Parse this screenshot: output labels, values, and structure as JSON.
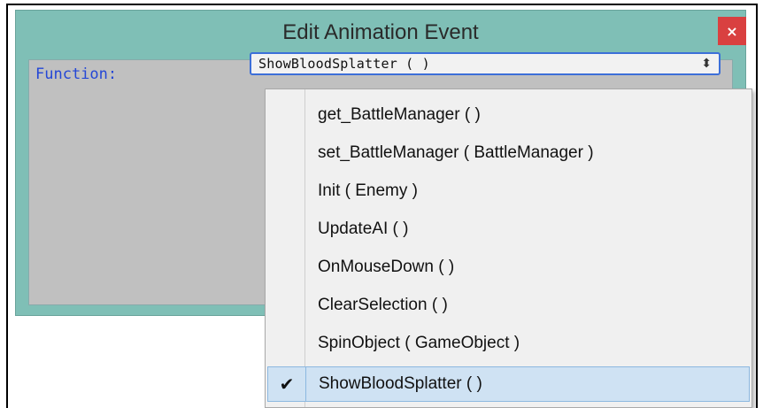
{
  "dialog": {
    "title": "Edit Animation Event",
    "close_label": "×"
  },
  "form": {
    "function_label": "Function:",
    "selected_value": "ShowBloodSplatter ( )",
    "arrow_glyph": "⬍"
  },
  "dropdown": {
    "items": [
      {
        "label": "get_BattleManager ( )",
        "checked": false
      },
      {
        "label": "set_BattleManager ( BattleManager )",
        "checked": false
      },
      {
        "label": "Init ( Enemy )",
        "checked": false
      },
      {
        "label": "UpdateAI ( )",
        "checked": false
      },
      {
        "label": "OnMouseDown ( )",
        "checked": false
      },
      {
        "label": "ClearSelection ( )",
        "checked": false
      },
      {
        "label": "SpinObject ( GameObject )",
        "checked": false
      },
      {
        "label": "ShowBloodSplatter ( )",
        "checked": true
      }
    ],
    "check_glyph": "✔"
  },
  "colors": {
    "dialog_bg": "#7fbfb6",
    "close_bg": "#d94040",
    "label_blue": "#2447d6",
    "selection_bg": "#cfe2f3"
  }
}
